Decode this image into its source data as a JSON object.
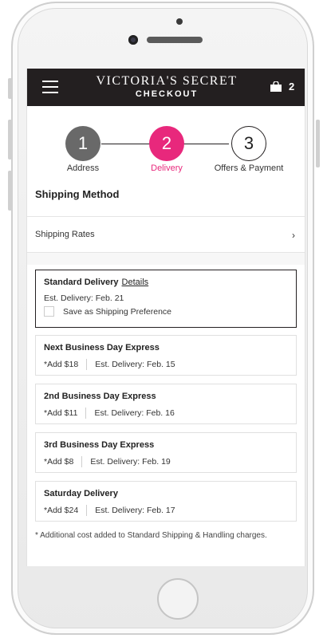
{
  "header": {
    "brand": "VICTORIA'S SECRET",
    "subtitle": "CHECKOUT",
    "bag_count": "2"
  },
  "stepper": {
    "steps": [
      {
        "number": "1",
        "label": "Address"
      },
      {
        "number": "2",
        "label": "Delivery"
      },
      {
        "number": "3",
        "label": "Offers & Payment"
      }
    ],
    "active_color": "#e8287c"
  },
  "shipping": {
    "title": "Shipping Method",
    "rates_label": "Shipping Rates",
    "options": [
      {
        "name": "Standard Delivery",
        "details_link": "Details",
        "delivery": "Est. Delivery: Feb. 21",
        "checkbox_label": "Save as Shipping Preference"
      },
      {
        "name": "Next Business Day Express",
        "cost": "*Add $18",
        "delivery": "Est. Delivery: Feb. 15"
      },
      {
        "name": "2nd Business Day Express",
        "cost": "*Add $11",
        "delivery": "Est. Delivery: Feb. 16"
      },
      {
        "name": "3rd Business Day Express",
        "cost": "*Add $8",
        "delivery": "Est. Delivery: Feb. 19"
      },
      {
        "name": "Saturday Delivery",
        "cost": "*Add $24",
        "delivery": "Est. Delivery: Feb. 17"
      }
    ],
    "footnote": "* Additional cost added to Standard Shipping & Handling charges."
  }
}
